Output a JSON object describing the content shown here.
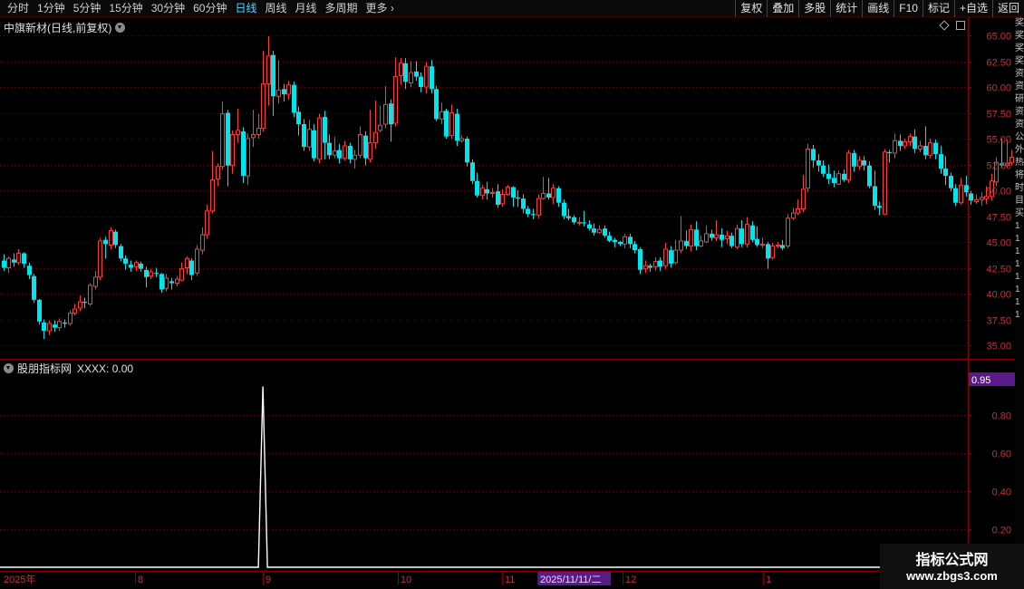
{
  "toolbar": {
    "periods": [
      "分时",
      "1分钟",
      "5分钟",
      "15分钟",
      "30分钟",
      "60分钟",
      "日线",
      "周线",
      "月线",
      "多周期",
      "更多"
    ],
    "active_period": "日线",
    "right_buttons": [
      "复权",
      "叠加",
      "多股",
      "统计",
      "画线",
      "F10",
      "标记",
      "+自选",
      "返回"
    ]
  },
  "main_panel": {
    "title": "中旗新材(日线,前复权)"
  },
  "indicator_panel": {
    "title": "股朋指标网",
    "value_label": "XXXX: 0.00",
    "current_value_tag": "0.95"
  },
  "watermark": {
    "line1": "指标公式网",
    "line2": "www.zbgs3.com"
  },
  "colors": {
    "up": "#ff3b3b",
    "down": "#00e5ee",
    "grid": "#5a0000",
    "axis_text": "#c83030",
    "indicator_line": "#ffffff",
    "highlight_bg": "#5b1a8a"
  },
  "chart_data": [
    {
      "type": "candlestick",
      "title": "中旗新材(日线,前复权)",
      "ylim": [
        34.5,
        66
      ],
      "yticks": [
        35.0,
        37.5,
        40.0,
        42.5,
        45.0,
        47.5,
        50.0,
        52.5,
        55.0,
        57.5,
        60.0,
        62.5,
        65.0
      ],
      "x_labels": [
        "2025年",
        "8",
        "9",
        "10",
        "11",
        "2025/11/11/二",
        "12",
        "1"
      ],
      "grid": true,
      "candles": [
        [
          43.2,
          42.5,
          43.8,
          42.2
        ],
        [
          42.5,
          43.4,
          43.6,
          42.0
        ],
        [
          43.3,
          43.0,
          43.9,
          42.6
        ],
        [
          43.0,
          43.9,
          44.3,
          42.8
        ],
        [
          43.9,
          42.9,
          44.0,
          42.5
        ],
        [
          42.7,
          41.8,
          43.0,
          41.4
        ],
        [
          41.7,
          39.4,
          41.9,
          39.1
        ],
        [
          39.4,
          37.3,
          39.5,
          37.0
        ],
        [
          37.2,
          36.4,
          37.5,
          35.6
        ],
        [
          36.4,
          37.1,
          37.4,
          36.0
        ],
        [
          37.0,
          36.7,
          37.4,
          36.3
        ],
        [
          36.7,
          37.3,
          37.6,
          36.4
        ],
        [
          37.2,
          37.1,
          37.5,
          36.7
        ],
        [
          37.1,
          38.1,
          38.4,
          36.9
        ],
        [
          38.1,
          38.5,
          39.0,
          37.9
        ],
        [
          38.6,
          39.2,
          39.8,
          38.3
        ],
        [
          39.2,
          39.1,
          39.6,
          38.6
        ],
        [
          39.0,
          40.8,
          41.0,
          38.8
        ],
        [
          40.7,
          41.6,
          42.2,
          40.4
        ],
        [
          41.6,
          45.1,
          45.4,
          41.3
        ],
        [
          45.2,
          44.8,
          45.5,
          43.4
        ],
        [
          44.7,
          46.1,
          46.4,
          44.3
        ],
        [
          46.0,
          44.7,
          46.2,
          44.4
        ],
        [
          44.6,
          43.4,
          44.8,
          43.1
        ],
        [
          43.4,
          42.9,
          43.7,
          42.3
        ],
        [
          42.8,
          42.5,
          43.2,
          42.1
        ],
        [
          42.6,
          43.0,
          43.2,
          42.2
        ],
        [
          42.9,
          42.4,
          43.1,
          42.1
        ],
        [
          42.3,
          41.6,
          42.6,
          40.6
        ],
        [
          41.7,
          42.1,
          42.4,
          41.4
        ],
        [
          42.0,
          41.9,
          42.5,
          41.6
        ],
        [
          41.9,
          40.4,
          42.0,
          40.1
        ],
        [
          40.5,
          41.5,
          41.9,
          40.2
        ],
        [
          41.2,
          41.0,
          41.5,
          40.4
        ],
        [
          41.0,
          41.4,
          41.7,
          40.7
        ],
        [
          41.3,
          42.4,
          43.0,
          41.2
        ],
        [
          42.5,
          43.4,
          43.6,
          41.9
        ],
        [
          43.2,
          41.8,
          43.4,
          41.3
        ],
        [
          42.0,
          44.3,
          44.7,
          41.7
        ],
        [
          44.2,
          45.7,
          46.4,
          43.8
        ],
        [
          45.7,
          48.0,
          48.6,
          45.3
        ],
        [
          48.0,
          51.0,
          53.8,
          47.8
        ],
        [
          51.1,
          52.3,
          52.6,
          50.4
        ],
        [
          52.3,
          57.4,
          58.6,
          52.0
        ],
        [
          57.5,
          52.4,
          57.8,
          50.4
        ],
        [
          52.4,
          55.4,
          55.8,
          51.6
        ],
        [
          55.4,
          55.8,
          57.9,
          54.6
        ],
        [
          55.7,
          51.4,
          56.1,
          50.7
        ],
        [
          51.4,
          55.0,
          55.5,
          50.5
        ],
        [
          55.1,
          55.4,
          57.8,
          54.2
        ],
        [
          55.4,
          56.0,
          57.4,
          55.0
        ],
        [
          56.0,
          60.3,
          63.5,
          55.7
        ],
        [
          60.3,
          63.0,
          64.9,
          58.2
        ],
        [
          63.1,
          59.1,
          63.5,
          57.2
        ],
        [
          59.1,
          59.7,
          62.6,
          58.4
        ],
        [
          59.8,
          59.3,
          60.3,
          58.6
        ],
        [
          59.3,
          60.2,
          60.6,
          58.8
        ],
        [
          60.2,
          57.5,
          60.5,
          57.1
        ],
        [
          57.6,
          56.4,
          58.1,
          55.3
        ],
        [
          56.4,
          54.2,
          56.9,
          53.8
        ],
        [
          54.2,
          55.9,
          56.8,
          53.8
        ],
        [
          55.8,
          53.1,
          56.4,
          52.8
        ],
        [
          53.0,
          57.0,
          57.4,
          52.6
        ],
        [
          57.1,
          54.6,
          57.7,
          53.0
        ],
        [
          54.6,
          53.4,
          55.4,
          53.0
        ],
        [
          53.4,
          53.8,
          55.2,
          53.1
        ],
        [
          53.9,
          53.1,
          54.5,
          52.6
        ],
        [
          53.1,
          54.3,
          54.8,
          52.9
        ],
        [
          54.3,
          53.0,
          54.6,
          52.6
        ],
        [
          53.0,
          53.4,
          53.9,
          52.1
        ],
        [
          53.4,
          55.4,
          56.2,
          53.1
        ],
        [
          55.3,
          53.1,
          55.7,
          52.4
        ],
        [
          53.0,
          54.6,
          57.8,
          52.7
        ],
        [
          54.6,
          55.6,
          58.7,
          54.0
        ],
        [
          55.8,
          56.3,
          58.2,
          55.6
        ],
        [
          56.4,
          58.3,
          60.1,
          56.0
        ],
        [
          58.4,
          56.4,
          58.8,
          54.7
        ],
        [
          56.5,
          61.0,
          62.9,
          56.2
        ],
        [
          61.1,
          62.3,
          62.8,
          60.2
        ],
        [
          62.3,
          60.5,
          62.8,
          59.8
        ],
        [
          60.4,
          61.4,
          62.5,
          60.0
        ],
        [
          61.5,
          61.0,
          62.5,
          60.6
        ],
        [
          61.0,
          60.0,
          61.4,
          59.5
        ],
        [
          60.0,
          62.0,
          62.4,
          59.4
        ],
        [
          62.0,
          59.8,
          62.6,
          59.4
        ],
        [
          59.8,
          56.9,
          60.1,
          56.7
        ],
        [
          56.9,
          57.6,
          58.5,
          56.4
        ],
        [
          57.7,
          55.2,
          57.9,
          55.0
        ],
        [
          55.3,
          57.5,
          58.3,
          55.0
        ],
        [
          57.4,
          54.8,
          57.9,
          54.3
        ],
        [
          54.8,
          55.0,
          55.3,
          54.6
        ],
        [
          55.0,
          52.7,
          55.2,
          52.3
        ],
        [
          52.7,
          50.9,
          53.0,
          50.6
        ],
        [
          50.9,
          49.5,
          51.7,
          49.3
        ],
        [
          49.5,
          50.2,
          50.5,
          49.1
        ],
        [
          50.1,
          49.7,
          50.8,
          49.1
        ],
        [
          49.7,
          49.8,
          50.2,
          49.3
        ],
        [
          49.9,
          48.6,
          50.6,
          48.3
        ],
        [
          48.7,
          49.6,
          50.1,
          48.4
        ],
        [
          49.6,
          50.3,
          50.5,
          49.5
        ],
        [
          50.3,
          49.3,
          50.4,
          48.4
        ],
        [
          49.3,
          49.2,
          50.0,
          48.4
        ],
        [
          49.2,
          48.2,
          49.6,
          47.8
        ],
        [
          48.2,
          47.7,
          48.5,
          47.4
        ],
        [
          47.7,
          47.6,
          48.2,
          47.2
        ],
        [
          47.6,
          49.2,
          49.6,
          47.3
        ],
        [
          49.2,
          49.7,
          51.3,
          49.1
        ],
        [
          49.7,
          49.3,
          51.2,
          49.1
        ],
        [
          49.3,
          50.2,
          50.6,
          48.7
        ],
        [
          50.2,
          48.8,
          50.4,
          48.4
        ],
        [
          48.8,
          47.5,
          49.1,
          47.2
        ],
        [
          47.5,
          47.3,
          48.2,
          47.1
        ],
        [
          47.4,
          46.9,
          47.6,
          46.7
        ],
        [
          46.9,
          46.9,
          47.4,
          46.6
        ],
        [
          46.9,
          46.8,
          48.0,
          46.5
        ],
        [
          46.7,
          46.3,
          47.1,
          46.1
        ],
        [
          46.3,
          45.9,
          46.8,
          45.6
        ],
        [
          45.9,
          46.2,
          46.6,
          45.8
        ],
        [
          46.3,
          45.6,
          46.6,
          45.4
        ],
        [
          45.6,
          45.1,
          46.0,
          45.0
        ],
        [
          45.2,
          45.0,
          45.4,
          44.5
        ],
        [
          45.0,
          44.8,
          45.1,
          44.6
        ],
        [
          44.8,
          45.5,
          45.8,
          44.4
        ],
        [
          45.5,
          44.8,
          45.8,
          44.4
        ],
        [
          44.8,
          44.2,
          45.1,
          43.9
        ],
        [
          44.3,
          42.3,
          44.5,
          41.9
        ],
        [
          42.4,
          42.7,
          43.2,
          42.0
        ],
        [
          42.7,
          42.5,
          42.9,
          42.1
        ],
        [
          42.6,
          43.1,
          43.5,
          42.2
        ],
        [
          43.2,
          42.6,
          43.5,
          42.2
        ],
        [
          42.7,
          44.3,
          44.9,
          42.4
        ],
        [
          44.2,
          42.9,
          44.6,
          42.5
        ],
        [
          43.0,
          44.2,
          45.2,
          42.8
        ],
        [
          44.2,
          45.1,
          47.5,
          43.9
        ],
        [
          45.1,
          44.6,
          46.1,
          44.3
        ],
        [
          44.6,
          46.2,
          46.7,
          44.1
        ],
        [
          46.2,
          44.6,
          47.0,
          44.2
        ],
        [
          44.6,
          45.1,
          45.6,
          44.5
        ],
        [
          45.0,
          45.8,
          46.6,
          44.9
        ],
        [
          45.8,
          45.4,
          46.2,
          45.1
        ],
        [
          45.4,
          45.7,
          47.1,
          45.1
        ],
        [
          45.7,
          45.2,
          46.3,
          44.5
        ],
        [
          45.3,
          45.6,
          46.1,
          44.8
        ],
        [
          45.6,
          44.6,
          45.9,
          44.4
        ],
        [
          44.5,
          46.3,
          46.7,
          44.3
        ],
        [
          46.3,
          44.8,
          47.1,
          44.5
        ],
        [
          44.8,
          46.7,
          47.4,
          44.5
        ],
        [
          46.6,
          45.2,
          47.0,
          45.0
        ],
        [
          45.3,
          44.7,
          46.5,
          44.5
        ],
        [
          44.7,
          44.8,
          45.4,
          44.4
        ],
        [
          44.8,
          43.4,
          45.0,
          42.4
        ],
        [
          43.5,
          44.6,
          44.9,
          43.3
        ],
        [
          44.6,
          44.7,
          45.0,
          44.4
        ],
        [
          44.7,
          44.4,
          45.2,
          44.2
        ],
        [
          44.6,
          47.3,
          47.7,
          44.4
        ],
        [
          47.3,
          47.8,
          48.3,
          47.1
        ],
        [
          47.8,
          48.2,
          49.1,
          47.6
        ],
        [
          48.2,
          50.1,
          51.5,
          47.9
        ],
        [
          50.2,
          54.0,
          54.5,
          49.8
        ],
        [
          54.0,
          52.9,
          54.4,
          52.2
        ],
        [
          52.9,
          52.4,
          53.5,
          51.8
        ],
        [
          52.4,
          51.6,
          52.9,
          51.3
        ],
        [
          51.6,
          51.1,
          52.5,
          50.6
        ],
        [
          51.2,
          50.7,
          51.9,
          50.3
        ],
        [
          50.6,
          51.6,
          51.9,
          50.5
        ],
        [
          51.6,
          51.0,
          52.0,
          50.8
        ],
        [
          51.0,
          53.6,
          53.9,
          50.7
        ],
        [
          53.6,
          52.3,
          53.9,
          51.8
        ],
        [
          52.3,
          52.9,
          53.3,
          52.0
        ],
        [
          52.9,
          52.4,
          53.3,
          51.9
        ],
        [
          52.4,
          50.4,
          52.8,
          50.2
        ],
        [
          50.4,
          48.5,
          51.9,
          48.1
        ],
        [
          48.5,
          48.3,
          48.9,
          47.6
        ],
        [
          47.7,
          53.7,
          54.0,
          47.6
        ],
        [
          53.7,
          53.6,
          53.9,
          52.7
        ],
        [
          53.6,
          54.8,
          55.5,
          53.1
        ],
        [
          54.8,
          54.3,
          55.4,
          53.8
        ],
        [
          54.3,
          54.7,
          55.0,
          54.0
        ],
        [
          54.7,
          55.2,
          55.5,
          54.3
        ],
        [
          55.2,
          54.0,
          55.9,
          53.6
        ],
        [
          54.0,
          54.3,
          54.8,
          53.7
        ],
        [
          54.3,
          53.4,
          56.2,
          53.0
        ],
        [
          53.4,
          54.6,
          55.0,
          53.1
        ],
        [
          54.6,
          53.5,
          54.9,
          53.0
        ],
        [
          53.5,
          52.1,
          54.3,
          51.6
        ],
        [
          52.1,
          51.4,
          53.3,
          50.5
        ],
        [
          51.4,
          50.2,
          51.7,
          49.9
        ],
        [
          50.2,
          48.8,
          50.6,
          48.5
        ],
        [
          48.8,
          50.5,
          51.2,
          48.6
        ],
        [
          50.5,
          49.8,
          51.4,
          49.4
        ],
        [
          49.7,
          49.0,
          50.0,
          48.6
        ],
        [
          48.9,
          49.1,
          49.6,
          48.7
        ],
        [
          49.1,
          49.3,
          49.8,
          48.5
        ],
        [
          49.2,
          49.4,
          50.4,
          48.7
        ],
        [
          49.4,
          50.9,
          51.6,
          49.0
        ],
        [
          50.8,
          52.7,
          53.2,
          50.4
        ],
        [
          52.6,
          52.4,
          55.0,
          52.2
        ],
        [
          52.4,
          52.6,
          54.9,
          52.2
        ],
        [
          52.7,
          53.2,
          53.9,
          52.4
        ],
        [
          53.2,
          52.4,
          53.6,
          51.2
        ]
      ]
    },
    {
      "type": "line",
      "title": "股朋指标网",
      "series": [
        {
          "name": "XXXX",
          "peak_index": 51,
          "peak_value": 0.95
        }
      ],
      "ylim": [
        0,
        1.02
      ],
      "yticks": [
        0.2,
        0.4,
        0.6,
        0.8
      ],
      "grid": true
    }
  ]
}
